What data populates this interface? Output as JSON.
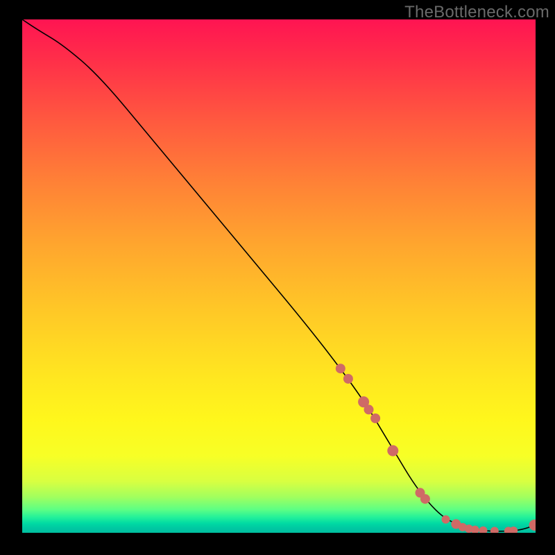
{
  "watermark": "TheBottleneck.com",
  "colors": {
    "background": "#000000",
    "curve": "#000000",
    "dots": "#cf6a66",
    "gradient_stops": [
      "#ff1452",
      "#ff2f49",
      "#ff5a3f",
      "#ff8236",
      "#ffa62e",
      "#ffc627",
      "#ffe321",
      "#fff71c",
      "#f7ff26",
      "#d8ff41",
      "#a2ff5e",
      "#5cff84",
      "#22f09a",
      "#00d9a3",
      "#00c9a2",
      "#00bfa0"
    ]
  },
  "chart_data": {
    "type": "line",
    "title": "",
    "xlabel": "",
    "ylabel": "",
    "xlim": [
      0,
      100
    ],
    "ylim": [
      0,
      100
    ],
    "grid": false,
    "legend": false,
    "x": [
      0,
      3,
      8,
      15,
      25,
      35,
      45,
      55,
      62,
      67,
      70,
      73,
      76,
      79,
      82,
      85,
      88,
      91,
      94,
      97,
      100
    ],
    "values": [
      100,
      98,
      95,
      89,
      77,
      65,
      53,
      41,
      32,
      25,
      20,
      15,
      10,
      6,
      3,
      1.5,
      0.7,
      0.3,
      0.3,
      0.5,
      1.5
    ],
    "dots_x": [
      62,
      63.5,
      66.5,
      67.5,
      68.8,
      72.2,
      77.5,
      78.5,
      82.5,
      84.5,
      85.8,
      87.0,
      88.2,
      89.8,
      92.0,
      94.7,
      95.7,
      99.8
    ],
    "dots_y": [
      32.0,
      30.0,
      25.5,
      24.0,
      22.3,
      16.0,
      7.8,
      6.6,
      2.6,
      1.7,
      1.1,
      0.8,
      0.6,
      0.45,
      0.35,
      0.35,
      0.4,
      1.5
    ],
    "dots_r": [
      7,
      7,
      8,
      7,
      7,
      8,
      7,
      7,
      6,
      7,
      6,
      6,
      6,
      6,
      6,
      6,
      6,
      8
    ]
  }
}
